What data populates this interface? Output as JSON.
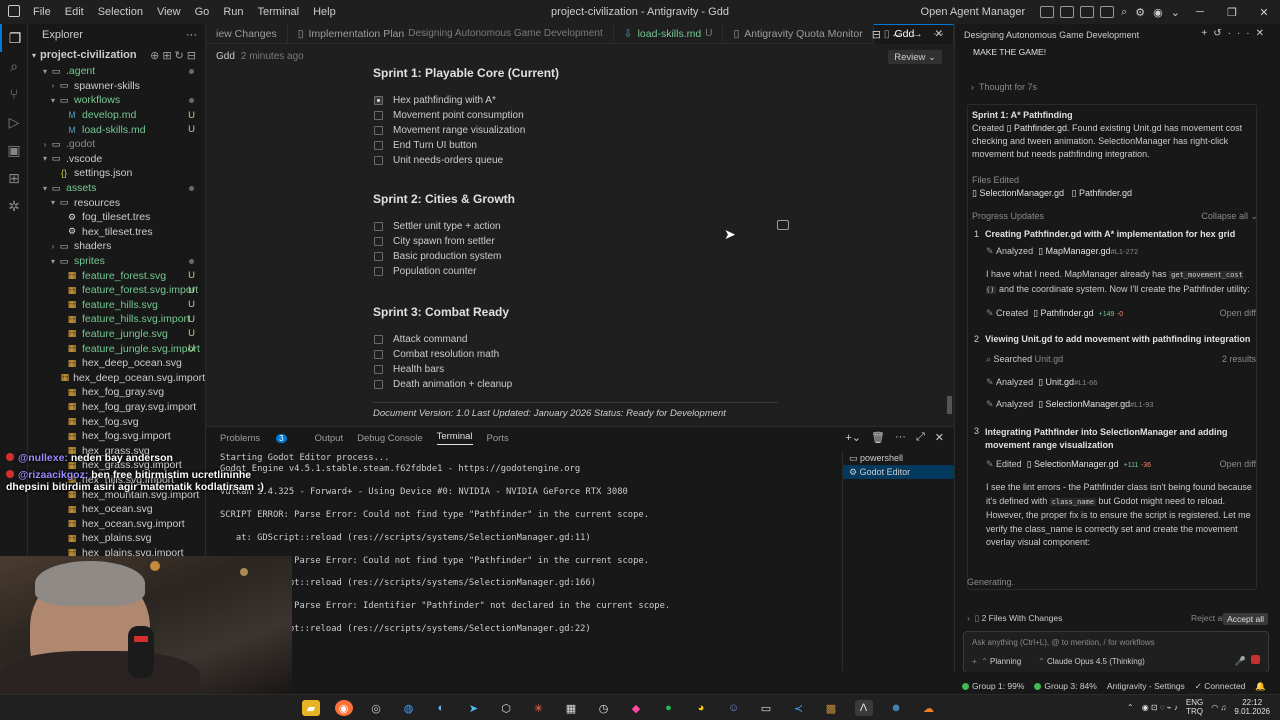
{
  "window": {
    "title": "project-civilization - Antigravity - Gdd",
    "menu": [
      "File",
      "Edit",
      "Selection",
      "View",
      "Go",
      "Run",
      "Terminal",
      "Help"
    ],
    "open_agent_manager": "Open Agent Manager"
  },
  "sidebar": {
    "header": "Explorer",
    "root": "project-civilization",
    "items": [
      {
        "label": ".agent",
        "depth": 1,
        "kind": "folder-open",
        "color": "green",
        "mark": "dot"
      },
      {
        "label": "spawner-skills",
        "depth": 2,
        "kind": "folder",
        "color": "normal",
        "mark": ""
      },
      {
        "label": "workflows",
        "depth": 2,
        "kind": "folder-open",
        "color": "green",
        "mark": "dot"
      },
      {
        "label": "develop.md",
        "depth": 3,
        "kind": "md",
        "color": "green",
        "mark": "U"
      },
      {
        "label": "load-skills.md",
        "depth": 3,
        "kind": "md",
        "color": "green",
        "mark": "U"
      },
      {
        "label": ".godot",
        "depth": 1,
        "kind": "folder",
        "color": "muted",
        "mark": ""
      },
      {
        "label": ".vscode",
        "depth": 1,
        "kind": "folder-open",
        "color": "normal",
        "mark": ""
      },
      {
        "label": "settings.json",
        "depth": 2,
        "kind": "json",
        "color": "normal",
        "mark": ""
      },
      {
        "label": "assets",
        "depth": 1,
        "kind": "folder-open",
        "color": "green",
        "mark": "dot"
      },
      {
        "label": "resources",
        "depth": 2,
        "kind": "folder-open",
        "color": "normal",
        "mark": ""
      },
      {
        "label": "fog_tileset.tres",
        "depth": 3,
        "kind": "gear",
        "color": "normal",
        "mark": ""
      },
      {
        "label": "hex_tileset.tres",
        "depth": 3,
        "kind": "gear",
        "color": "normal",
        "mark": ""
      },
      {
        "label": "shaders",
        "depth": 2,
        "kind": "folder",
        "color": "normal",
        "mark": ""
      },
      {
        "label": "sprites",
        "depth": 2,
        "kind": "folder-open",
        "color": "green",
        "mark": "dot"
      },
      {
        "label": "feature_forest.svg",
        "depth": 3,
        "kind": "svg",
        "color": "green",
        "mark": "U"
      },
      {
        "label": "feature_forest.svg.import",
        "depth": 3,
        "kind": "svg",
        "color": "green",
        "mark": "U"
      },
      {
        "label": "feature_hills.svg",
        "depth": 3,
        "kind": "svg",
        "color": "green",
        "mark": "U"
      },
      {
        "label": "feature_hills.svg.import",
        "depth": 3,
        "kind": "svg",
        "color": "green",
        "mark": "U"
      },
      {
        "label": "feature_jungle.svg",
        "depth": 3,
        "kind": "svg",
        "color": "green",
        "mark": "U"
      },
      {
        "label": "feature_jungle.svg.import",
        "depth": 3,
        "kind": "svg",
        "color": "green",
        "mark": "U"
      },
      {
        "label": "hex_deep_ocean.svg",
        "depth": 3,
        "kind": "svg",
        "color": "normal",
        "mark": ""
      },
      {
        "label": "hex_deep_ocean.svg.import",
        "depth": 3,
        "kind": "svg",
        "color": "normal",
        "mark": ""
      },
      {
        "label": "hex_fog_gray.svg",
        "depth": 3,
        "kind": "svg",
        "color": "normal",
        "mark": ""
      },
      {
        "label": "hex_fog_gray.svg.import",
        "depth": 3,
        "kind": "svg",
        "color": "normal",
        "mark": ""
      },
      {
        "label": "hex_fog.svg",
        "depth": 3,
        "kind": "svg",
        "color": "normal",
        "mark": ""
      },
      {
        "label": "hex_fog.svg.import",
        "depth": 3,
        "kind": "svg",
        "color": "normal",
        "mark": ""
      },
      {
        "label": "hex_grass.svg",
        "depth": 3,
        "kind": "svg",
        "color": "normal",
        "mark": ""
      },
      {
        "label": "hex_grass.svg.import",
        "depth": 3,
        "kind": "svg",
        "color": "normal",
        "mark": ""
      },
      {
        "label": "hex_hills.svg.import",
        "depth": 3,
        "kind": "svg",
        "color": "normal",
        "mark": ""
      },
      {
        "label": "hex_mountain.svg.import",
        "depth": 3,
        "kind": "svg",
        "color": "normal",
        "mark": ""
      },
      {
        "label": "hex_ocean.svg",
        "depth": 3,
        "kind": "svg",
        "color": "normal",
        "mark": ""
      },
      {
        "label": "hex_ocean.svg.import",
        "depth": 3,
        "kind": "svg",
        "color": "normal",
        "mark": ""
      },
      {
        "label": "hex_plains.svg",
        "depth": 3,
        "kind": "svg",
        "color": "normal",
        "mark": ""
      },
      {
        "label": "hex_plains.svg.import",
        "depth": 3,
        "kind": "svg",
        "color": "normal",
        "mark": ""
      }
    ]
  },
  "tabs": [
    {
      "label": "iew Changes",
      "desc": "",
      "active": false,
      "icon": ""
    },
    {
      "label": "Implementation Plan",
      "desc": "Designing Autonomous Game Development",
      "active": false,
      "icon": "doc"
    },
    {
      "label": "load-skills.md",
      "desc": "U",
      "active": false,
      "icon": "md"
    },
    {
      "label": "Antigravity Quota Monitor",
      "desc": "",
      "active": false,
      "icon": "doc"
    },
    {
      "label": "Gdd",
      "desc": "",
      "active": true,
      "icon": "doc"
    }
  ],
  "editor": {
    "breadcrumb": "Gdd",
    "edited": "2 minutes ago",
    "review": "Review",
    "sprints": [
      {
        "title": "Sprint 1: Playable Core (Current)",
        "tasks": [
          {
            "label": "Hex pathfinding with A*",
            "checked": true
          },
          {
            "label": "Movement point consumption",
            "checked": false
          },
          {
            "label": "Movement range visualization",
            "checked": false
          },
          {
            "label": "End Turn UI button",
            "checked": false
          },
          {
            "label": "Unit needs-orders queue",
            "checked": false
          }
        ]
      },
      {
        "title": "Sprint 2: Cities & Growth",
        "tasks": [
          {
            "label": "Settler unit type + action",
            "checked": false
          },
          {
            "label": "City spawn from settler",
            "checked": false
          },
          {
            "label": "Basic production system",
            "checked": false
          },
          {
            "label": "Population counter",
            "checked": false
          }
        ]
      },
      {
        "title": "Sprint 3: Combat Ready",
        "tasks": [
          {
            "label": "Attack command",
            "checked": false
          },
          {
            "label": "Combat resolution math",
            "checked": false
          },
          {
            "label": "Health bars",
            "checked": false
          },
          {
            "label": "Death animation + cleanup",
            "checked": false
          }
        ]
      }
    ],
    "footer": "Document Version: 1.0 Last Updated: January 2026 Status: Ready for Development"
  },
  "panel": {
    "tabs": [
      "Problems",
      "Output",
      "Debug Console",
      "Terminal",
      "Ports"
    ],
    "problems_count": "3",
    "active_tab": "Terminal",
    "terminal_lines": [
      "Starting Godot Editor process...",
      "Godot Engine v4.5.1.stable.steam.f62fdbde1 - https://godotengine.org",
      "",
      "Vulkan 1.4.325 - Forward+ - Using Device #0: NVIDIA - NVIDIA GeForce RTX 3080",
      "",
      "SCRIPT ERROR: Parse Error: Could not find type \"Pathfinder\" in the current scope.",
      "",
      "   at: GDScript::reload (res://scripts/systems/SelectionManager.gd:11)",
      "",
      "SCRIPT ERROR: Parse Error: Could not find type \"Pathfinder\" in the current scope.",
      "",
      "   at: GDScript::reload (res://scripts/systems/SelectionManager.gd:166)",
      "",
      "SCRIPT ERROR: Parse Error: Identifier \"Pathfinder\" not declared in the current scope.",
      "",
      "   at: GDScript::reload (res://scripts/systems/SelectionManager.gd:22)"
    ],
    "terminals": [
      "powershell",
      "Godot Editor"
    ]
  },
  "agent": {
    "title": "Designing Autonomous Game Development",
    "user_message": "MAKE THE GAME!",
    "thought": "Thought for 7s",
    "summary_title": "Sprint 1: A* Pathfinding",
    "summary_created": "Created",
    "summary_file": "Pathfinder.gd",
    "summary_text": ". Found existing Unit.gd has movement cost checking and tween animation. SelectionManager has right-click movement but needs pathfinding integration.",
    "files_edited_label": "Files Edited",
    "files_edited": [
      "SelectionManager.gd",
      "Pathfinder.gd"
    ],
    "progress_label": "Progress Updates",
    "collapse_all": "Collapse all",
    "steps": [
      {
        "num": "1",
        "title": "Creating Pathfinder.gd with A* implementation for hex grid"
      },
      {
        "num": "2",
        "title": "Viewing Unit.gd to add movement with pathfinding integration"
      },
      {
        "num": "3",
        "title": "Integrating Pathfinder into SelectionManager and adding movement range visualization"
      }
    ],
    "s1_analyzed": "Analyzed",
    "s1_file": "MapManager.gd",
    "s1_range": "#L1-272",
    "s1_text_a": "I have what I need. MapManager already has",
    "s1_code": "get_movement_cost ()",
    "s1_text_b": "and the coordinate system. Now I'll create the Pathfinder utility:",
    "s1_created": "Created",
    "s1_created_file": "Pathfinder.gd",
    "s1_plus": "+149",
    "s1_minus": "-0",
    "open_diff": "Open diff",
    "s2_searched": "Searched",
    "s2_query": "Unit.gd",
    "s2_results": "2 results",
    "s2_analyzed1": "Analyzed",
    "s2_file1": "Unit.gd",
    "s2_range1": "#L1-66",
    "s2_analyzed2": "Analyzed",
    "s2_file2": "SelectionManager.gd",
    "s2_range2": "#L1-93",
    "s3_edited": "Edited",
    "s3_file": "SelectionManager.gd",
    "s3_plus": "+111",
    "s3_minus": "-36",
    "s3_text_a": "I see the lint errors - the Pathfinder class isn't being found because it's defined with",
    "s3_code": "class_name",
    "s3_text_b": "but Godot might need to reload. However, the proper fix is to ensure the script is registered. Let me verify the class_name is correctly set and create the movement overlay visual component:",
    "generating": "Generating.",
    "files_with_changes": "2 Files With Changes",
    "reject_all": "Reject all",
    "accept_all": "Accept all",
    "input_placeholder": "Ask anything (Ctrl+L), @ to mention, / for workflows",
    "mode": "Planning",
    "model": "Claude Opus 4.5 (Thinking)"
  },
  "status": {
    "group1": "Group 1: 99%",
    "group3": "Group 3: 84%",
    "settings": "Antigravity - Settings",
    "connected": "Connected"
  },
  "taskbar": {
    "lang_top": "ENG",
    "lang_bottom": "TRQ",
    "time": "22:12",
    "date": "9.01.2026"
  },
  "chat": [
    {
      "user": "@nullexe:",
      "message": "neden bay anderson"
    },
    {
      "user": "@rizaacikgoz:",
      "message": "ben free bitirmistim ucretlininhe dhepsini bitirdim asiri agir matematik kodlatirsam :)"
    }
  ],
  "colors": {
    "accent": "#0078d4",
    "git_untracked": "#73c991",
    "git_modified": "#e2c08d",
    "error": "#c53030"
  }
}
